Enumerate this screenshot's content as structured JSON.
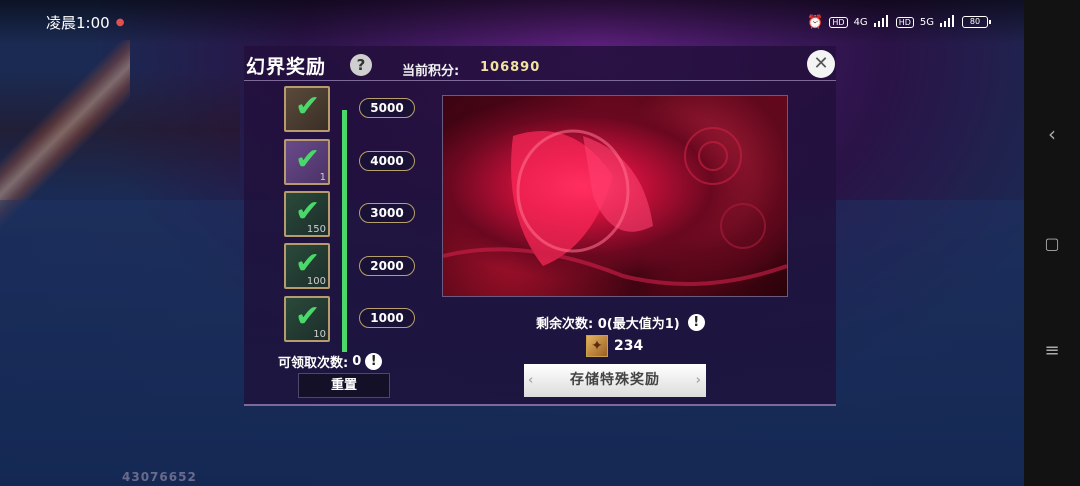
{
  "status_bar": {
    "time": "凌晨1:00",
    "net1": "4G",
    "net2": "5G",
    "hd": "HD",
    "battery": "80"
  },
  "dialog": {
    "title": "幻界奖励",
    "help": "?",
    "score_label": "当前积分:",
    "score_value": "106890",
    "close": "✕"
  },
  "rewards": [
    {
      "threshold": "5000",
      "count": "",
      "claimed": true,
      "style": "brown"
    },
    {
      "threshold": "4000",
      "count": "1",
      "claimed": true,
      "style": "purple"
    },
    {
      "threshold": "3000",
      "count": "150",
      "claimed": true,
      "style": "green"
    },
    {
      "threshold": "2000",
      "count": "100",
      "claimed": true,
      "style": "green"
    },
    {
      "threshold": "1000",
      "count": "10",
      "claimed": true,
      "style": "green"
    }
  ],
  "claimable": {
    "label": "可领取次数:",
    "value": "0"
  },
  "reset_button": "重置",
  "remaining": {
    "text": "剩余次数: 0(最大值为1)"
  },
  "currency": {
    "value": "234"
  },
  "store_button": "存储特殊奖励",
  "uid": "43076652",
  "icons": {
    "check": "✔",
    "warn": "!",
    "alarm": "⏰",
    "back": "‹",
    "home": "▢",
    "menu": "≡",
    "arrow_l": "‹",
    "arrow_r": "›"
  }
}
